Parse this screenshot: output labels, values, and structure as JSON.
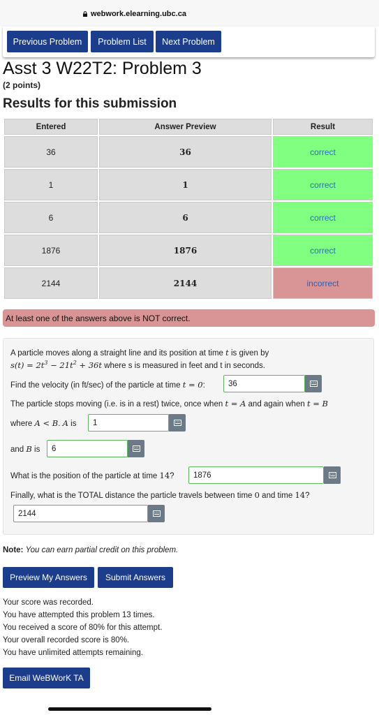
{
  "browser": {
    "url": "webwork.elearning.ubc.ca"
  },
  "nav": {
    "prev": "Previous Problem",
    "list": "Problem List",
    "next": "Next Problem"
  },
  "heading": {
    "title": "Asst 3 W22T2: Problem 3",
    "points": "(2 points)",
    "results": "Results for this submission"
  },
  "table": {
    "headers": [
      "Entered",
      "Answer Preview",
      "Result"
    ],
    "rows": [
      {
        "entered": "36",
        "preview": "36",
        "result": "correct"
      },
      {
        "entered": "1",
        "preview": "1",
        "result": "correct"
      },
      {
        "entered": "6",
        "preview": "6",
        "result": "correct"
      },
      {
        "entered": "1876",
        "preview": "1876",
        "result": "correct"
      },
      {
        "entered": "2144",
        "preview": "2144",
        "result": "incorrect"
      }
    ]
  },
  "colors": {
    "correct": "#80ff80",
    "incorrect": "#d99595",
    "button": "#1c3c8c"
  },
  "alert": "At least one of the answers above is NOT correct.",
  "problem": {
    "l1": "A particle moves along a straight line and its position at time",
    "l1_var": "t",
    "l1_end": "is given by",
    "formula_a": "s(t) = 2t",
    "formula_b": "3",
    "formula_c": " − 21t",
    "formula_d": "2",
    "formula_e": " + 36t",
    "l2_end": "where s is measured in feet and t in seconds.",
    "q1_pre": "Find the velocity (in ft/sec) of the particle at time",
    "q1_math": "t = 0",
    "q1_post": ":",
    "a1": "36",
    "q2_pre": "The particle stops moving (i.e. is in a rest) twice, once when",
    "q2_m1": "t = A",
    "q2_mid": "and again when",
    "q2_m2": "t = B",
    "q2b_pre": "where",
    "q2b_m": "A < B",
    "q2b_mid": ".",
    "q2b_A": "A",
    "q2b_is": "is",
    "a2": "1",
    "q3_pre": "and",
    "q3_B": "B",
    "q3_is": "is",
    "a3": "6",
    "q4_pre": "What is the position of the particle at time",
    "q4_m": "14",
    "q4_post": "?",
    "a4": "1876",
    "q5_pre": "Finally, what is the TOTAL distance the particle travels between time",
    "q5_m1": "0",
    "q5_mid": "and time",
    "q5_m2": "14",
    "q5_post": "?",
    "a5": "2144"
  },
  "note": {
    "label": "Note:",
    "text": "You can earn partial credit on this problem."
  },
  "buttons": {
    "preview": "Preview My Answers",
    "submit": "Submit Answers",
    "email": "Email WeBWorK TA"
  },
  "messages": [
    "Your score was recorded.",
    "You have attempted this problem 13 times.",
    "You received a score of 80% for this attempt.",
    "Your overall recorded score is 80%.",
    "You have unlimited attempts remaining."
  ],
  "icons": {
    "lock": "lock-icon",
    "keyboard": "equation-editor-icon"
  }
}
